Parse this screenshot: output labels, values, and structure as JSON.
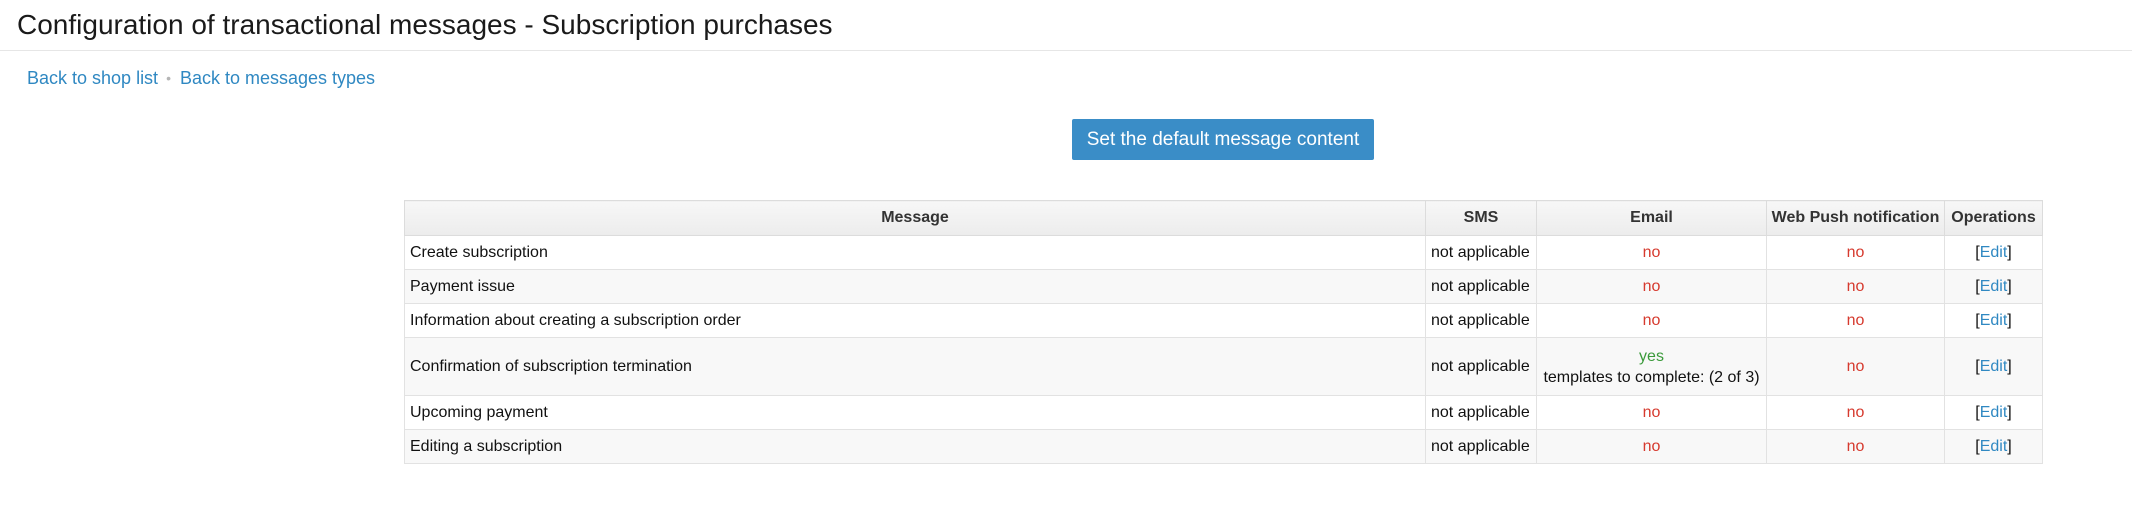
{
  "page": {
    "title": "Configuration of transactional messages - Subscription purchases"
  },
  "nav": {
    "back_shop_list": "Back to shop list",
    "separator": "•",
    "back_message_types": "Back to messages types"
  },
  "actions": {
    "default_content_label": "Set the default message content"
  },
  "table": {
    "columns": [
      "Message",
      "SMS",
      "Email",
      "Web Push notification",
      "Operations"
    ],
    "rows": [
      {
        "message": "Create subscription",
        "sms": "not applicable",
        "email": "no",
        "email_note": "",
        "push": "no",
        "op": "Edit"
      },
      {
        "message": "Payment issue",
        "sms": "not applicable",
        "email": "no",
        "email_note": "",
        "push": "no",
        "op": "Edit"
      },
      {
        "message": "Information about creating a subscription order",
        "sms": "not applicable",
        "email": "no",
        "email_note": "",
        "push": "no",
        "op": "Edit"
      },
      {
        "message": "Confirmation of subscription termination",
        "sms": "not applicable",
        "email": "yes",
        "email_note": "templates to complete: (2 of 3)",
        "push": "no",
        "op": "Edit"
      },
      {
        "message": "Upcoming payment",
        "sms": "not applicable",
        "email": "no",
        "email_note": "",
        "push": "no",
        "op": "Edit"
      },
      {
        "message": "Editing a subscription",
        "sms": "not applicable",
        "email": "no",
        "email_note": "",
        "push": "no",
        "op": "Edit"
      }
    ]
  },
  "colors": {
    "link": "#2f88c2",
    "button": "#3a8dc7",
    "status_no": "#d63a2e",
    "status_yes": "#3a9a3a"
  }
}
